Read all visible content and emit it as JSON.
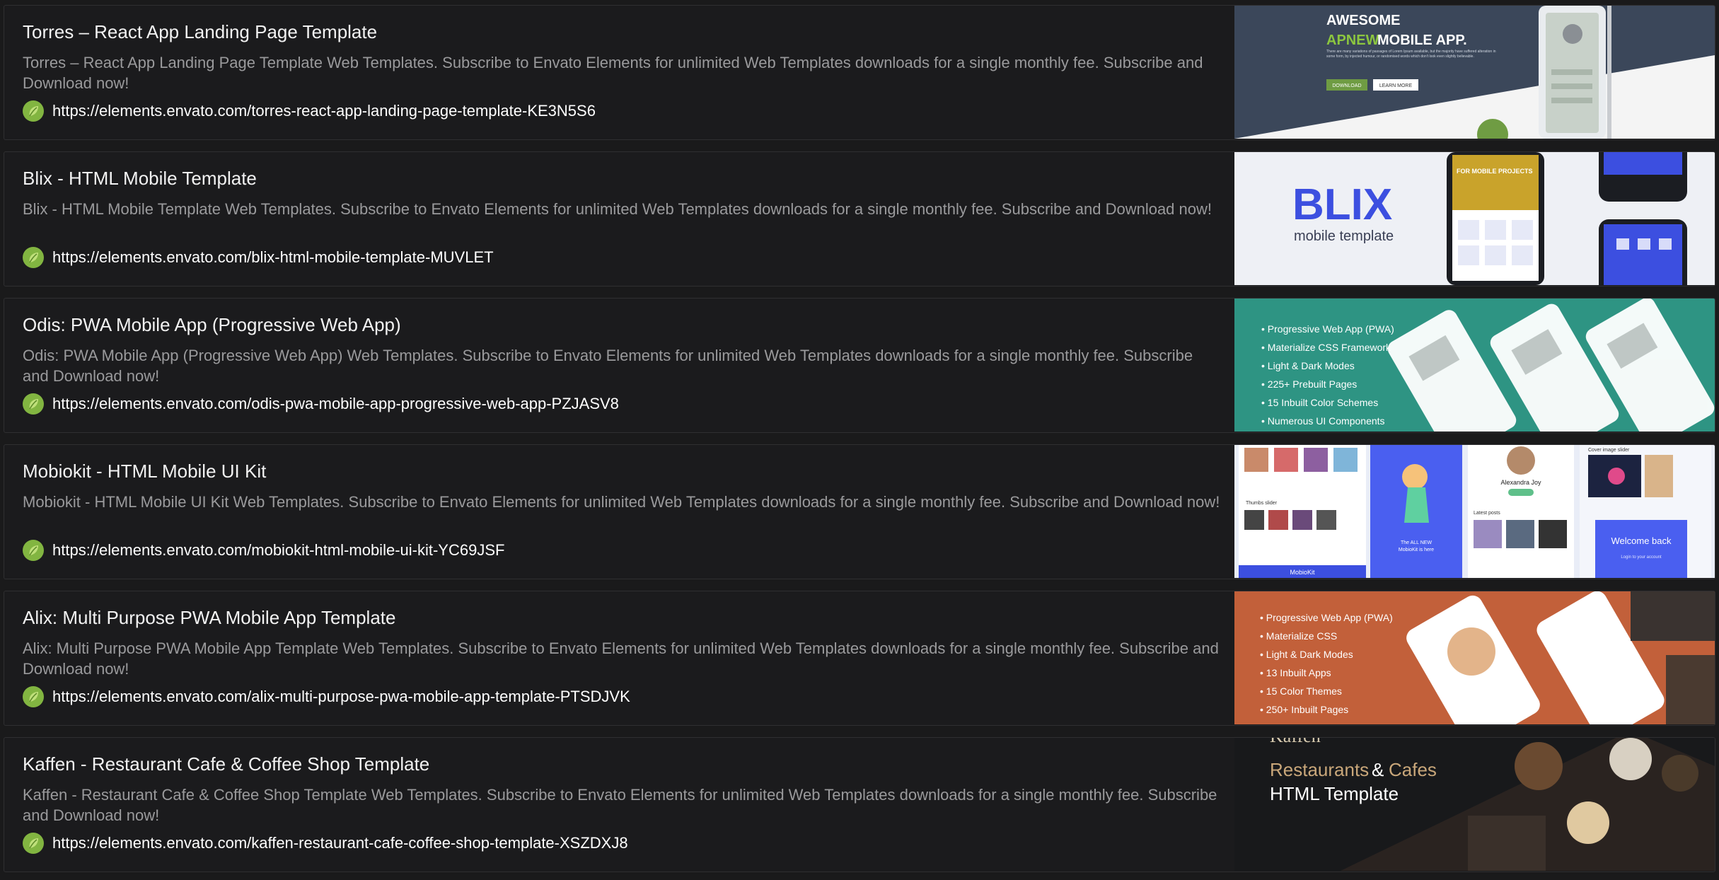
{
  "results": [
    {
      "title": "Torres – React App Landing Page Template",
      "description": "Torres – React App Landing Page Template Web Templates. Subscribe to Envato Elements for unlimited Web Templates downloads for a single monthly fee. Subscribe and Download now!",
      "url": "https://elements.envato.com/torres-react-app-landing-page-template-KE3N5S6",
      "thumb": {
        "headline1": "AWESOME",
        "headline2a": "APNEW",
        "headline2b": "MOBILE APP.",
        "body": "There are many variations of passages of Lorem Ipsum available, but the majority have suffered alteration in some form, by injected humour, or randomised words which don't look even slightly believable.",
        "btn1": "DOWNLOAD",
        "btn2": "LEARN MORE"
      }
    },
    {
      "title": "Blix - HTML Mobile Template",
      "description": "Blix - HTML Mobile Template Web Templates. Subscribe to Envato Elements for unlimited Web Templates downloads for a single monthly fee. Subscribe and Download now!",
      "url": "https://elements.envato.com/blix-html-mobile-template-MUVLET",
      "thumb": {
        "logo": "BLIX",
        "sub": "mobile template",
        "phone_text": "FOR MOBILE PROJECTS"
      }
    },
    {
      "title": "Odis: PWA Mobile App (Progressive Web App)",
      "description": "Odis: PWA Mobile App (Progressive Web App) Web Templates. Subscribe to Envato Elements for unlimited Web Templates downloads for a single monthly fee. Subscribe and Download now!",
      "url": "https://elements.envato.com/odis-pwa-mobile-app-progressive-web-app-PZJASV8",
      "thumb": {
        "features": [
          "• Progressive Web App (PWA)",
          "• Materialize CSS Framework",
          "• Light & Dark Modes",
          "• 225+ Prebuilt Pages",
          "• 15 Inbuilt Color Schemes",
          "• Numerous UI Components"
        ]
      }
    },
    {
      "title": "Mobiokit - HTML Mobile UI Kit",
      "description": "Mobiokit - HTML Mobile UI Kit Web Templates. Subscribe to Envato Elements for unlimited Web Templates downloads for a single monthly fee. Subscribe and Download now!",
      "url": "https://elements.envato.com/mobiokit-html-mobile-ui-kit-YC69JSF",
      "thumb": {
        "profile_name": "Alexandra Joy",
        "welcome": "Welcome back",
        "login_hint": "Login to your account",
        "cover_label": "Cover image slider",
        "all_new_a": "The ALL NEW",
        "all_new_b": "MobioKit is here",
        "brand": "MobioKit",
        "latest": "Latest posts",
        "slider": "Thumbs slider"
      }
    },
    {
      "title": "Alix: Multi Purpose PWA Mobile App Template",
      "description": "Alix: Multi Purpose PWA Mobile App Template Web Templates. Subscribe to Envato Elements for unlimited Web Templates downloads for a single monthly fee. Subscribe and Download now!",
      "url": "https://elements.envato.com/alix-multi-purpose-pwa-mobile-app-template-PTSDJVK",
      "thumb": {
        "features": [
          "• Progressive Web App (PWA)",
          "• Materialize CSS",
          "• Light & Dark Modes",
          "• 13 Inbuilt Apps",
          "• 15 Color Themes",
          "• 250+ Inbuilt Pages"
        ]
      }
    },
    {
      "title": "Kaffen - Restaurant Cafe & Coffee Shop Template",
      "description": "Kaffen - Restaurant Cafe & Coffee Shop Template Web Templates. Subscribe to Envato Elements for unlimited Web Templates downloads for a single monthly fee. Subscribe and Download now!",
      "url": "https://elements.envato.com/kaffen-restaurant-cafe-coffee-shop-template-XSZDXJ8",
      "thumb": {
        "brand": "Kaffen",
        "line1a": "Restaurants",
        "line1b": "&",
        "line1c": "Cafes",
        "line2": "HTML Template"
      }
    }
  ],
  "colors": {
    "page_bg": "#1a1a1b",
    "card_bg": "#1b1b1d",
    "card_border": "#2f2f31",
    "title": "#f2f2f2",
    "description": "#9a9a9c",
    "url": "#ffffff",
    "envato_leaf": "#82b541"
  },
  "icons": {
    "site_favicon": "envato-leaf-icon"
  }
}
